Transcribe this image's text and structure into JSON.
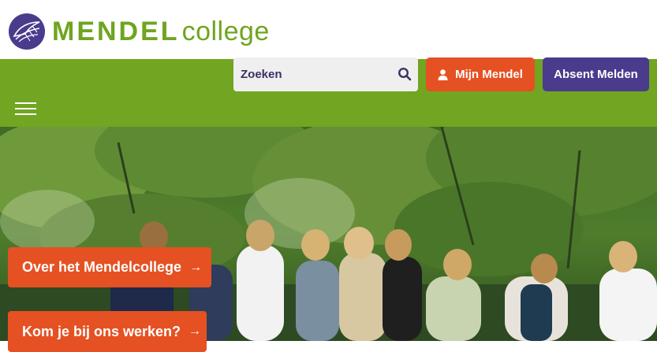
{
  "site": {
    "logo_main": "MENDEL",
    "logo_sub": "college"
  },
  "search": {
    "placeholder": "Zoeken"
  },
  "actions": {
    "mijn_mendel": "Mijn Mendel",
    "absent_melden": "Absent Melden"
  },
  "hero": {
    "cta_over": "Over het Mendelcollege",
    "cta_werken": "Kom je bij ons werken?",
    "arrow": "→"
  },
  "colors": {
    "brand_green": "#72a521",
    "accent_orange": "#e55122",
    "brand_purple": "#4a3b8c"
  },
  "icons": [
    "mendel-emblem-icon",
    "search-icon",
    "user-icon",
    "menu-icon",
    "arrow-right-icon"
  ]
}
